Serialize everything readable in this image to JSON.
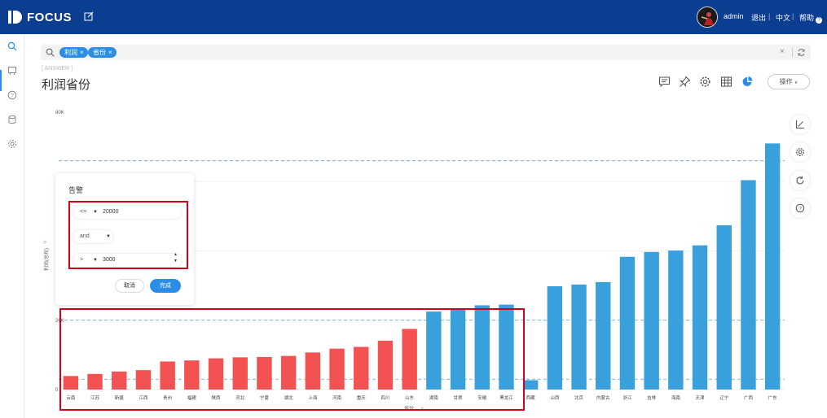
{
  "header": {
    "logo_text": "FOCUS",
    "user": "admin",
    "logout": "退出",
    "language": "中文",
    "help": "帮助",
    "sep": "|"
  },
  "search": {
    "tags": [
      {
        "label": "利润"
      },
      {
        "label": "省份"
      }
    ],
    "tag_remove": "×",
    "clear": "×"
  },
  "answer": {
    "label": "[ ANSWER ]",
    "title": "利润省份",
    "ops_label": "操作"
  },
  "icons": {
    "toolbar": [
      "comment-icon",
      "pin-icon",
      "gear-icon",
      "table-icon",
      "pie-chart-icon"
    ],
    "right_tools": [
      "axis-icon",
      "settings-icon",
      "refresh-icon",
      "help-icon"
    ]
  },
  "alert": {
    "title": "告警",
    "rule1": {
      "op": "<=",
      "value": "20000"
    },
    "connector": "and",
    "rule2": {
      "op": ">",
      "value": "3000"
    },
    "cancel": "取消",
    "done": "完成"
  },
  "chart_data": {
    "type": "bar",
    "ylabel": "利润(总和)",
    "xlabel": "省份",
    "ytick_labels": [
      "80K",
      "20K",
      "0"
    ],
    "ylim": [
      0,
      80000
    ],
    "reference_lines": [
      3000,
      20000,
      66000
    ],
    "categories": [
      "云南",
      "江苏",
      "新疆",
      "江西",
      "贵州",
      "福建",
      "陕西",
      "河北",
      "宁夏",
      "湖北",
      "上海",
      "河南",
      "重庆",
      "四川",
      "山东",
      "湖南",
      "甘肃",
      "安徽",
      "黑龙江",
      "西藏",
      "山西",
      "北京",
      "内蒙古",
      "浙江",
      "吉林",
      "海南",
      "天津",
      "辽宁",
      "广西",
      "广东"
    ],
    "values": [
      3900,
      4500,
      5200,
      5600,
      8100,
      8400,
      9000,
      9300,
      9400,
      9700,
      10700,
      11800,
      12300,
      14100,
      17500,
      22500,
      23200,
      24300,
      24500,
      2700,
      29800,
      30300,
      31000,
      38300,
      39700,
      40100,
      41600,
      47400,
      60400,
      71000
    ],
    "colors": {
      "alert": "#f25252",
      "normal": "#3aa0db",
      "reference": "#5a9fd4"
    },
    "alert_range": [
      3000,
      20000
    ],
    "grid": true
  }
}
